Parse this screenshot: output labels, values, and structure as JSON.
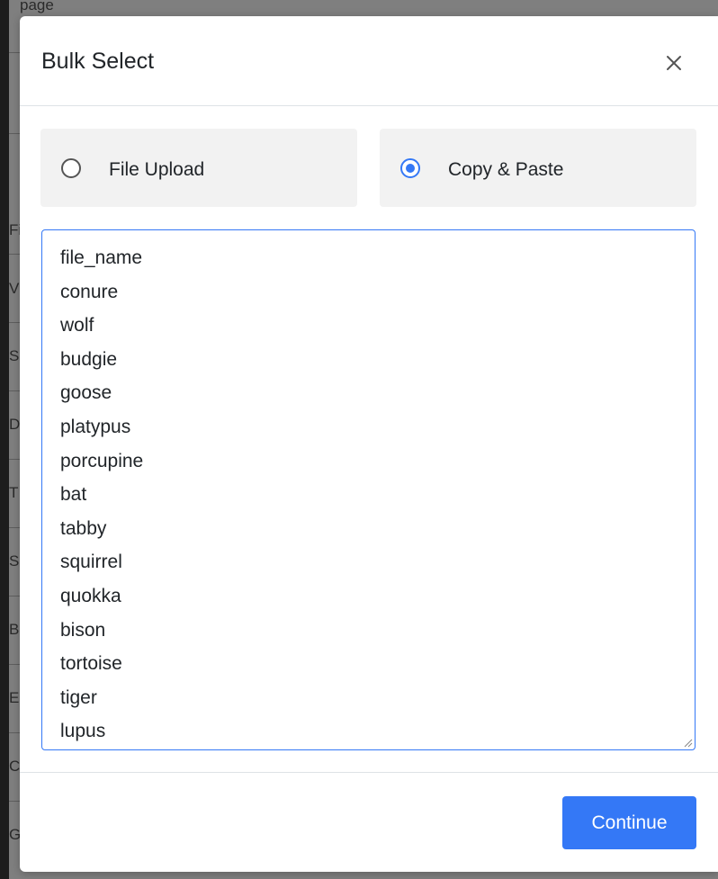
{
  "background": {
    "top_text": "page",
    "row_letters": [
      "Fi",
      "V",
      "S",
      "D",
      "T",
      "S",
      "B",
      "E",
      "C",
      "G"
    ]
  },
  "modal": {
    "title": "Bulk Select",
    "close_icon": "close-icon",
    "options": [
      {
        "label": "File Upload",
        "selected": false
      },
      {
        "label": "Copy & Paste",
        "selected": true
      }
    ],
    "textarea_lines": [
      "file_name",
      "conure",
      "wolf",
      "budgie",
      "goose",
      "platypus",
      "porcupine",
      "bat",
      "tabby",
      "squirrel",
      "quokka",
      "bison",
      "tortoise",
      "tiger",
      "lupus"
    ],
    "continue_label": "Continue"
  },
  "colors": {
    "accent": "#3478f6",
    "card_bg": "#f2f2f2",
    "text": "#212529",
    "divider": "#dee2e6"
  }
}
